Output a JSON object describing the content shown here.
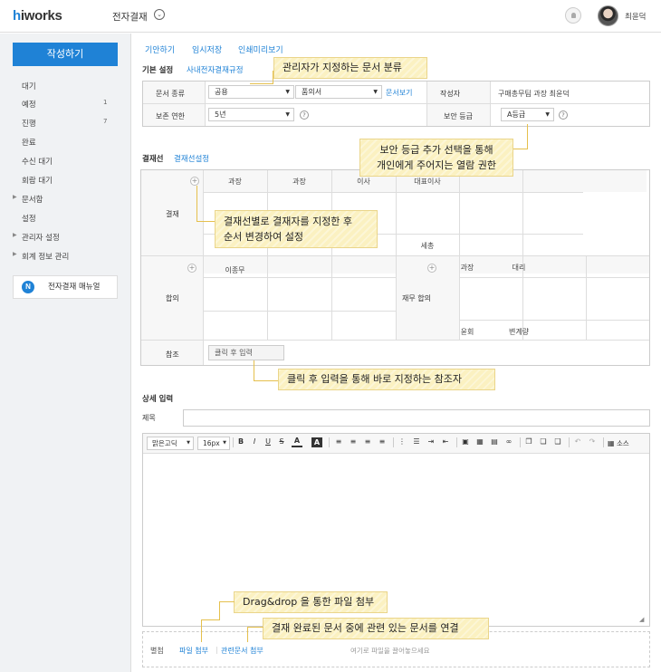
{
  "header": {
    "logo_h": "h",
    "logo_rest": "iworks",
    "app_title": "전자결재",
    "chevron": "⌄",
    "user_name": "최윤덕"
  },
  "sidebar": {
    "write_button": "작성하기",
    "items": [
      {
        "label": "대기",
        "count": ""
      },
      {
        "label": "예정",
        "count": "1"
      },
      {
        "label": "진행",
        "count": "7"
      },
      {
        "label": "완료",
        "count": ""
      },
      {
        "label": "수신 대기",
        "count": ""
      },
      {
        "label": "회람 대기",
        "count": ""
      },
      {
        "label": "문서함",
        "count": ""
      },
      {
        "label": "설정",
        "count": ""
      },
      {
        "label": "관리자 설정",
        "count": ""
      },
      {
        "label": "회계 정보 관리",
        "count": ""
      }
    ],
    "manual_icon": "N",
    "manual_label": "전자결재 매뉴얼"
  },
  "actions": {
    "draft": "기안하기",
    "temp_save": "임시저장",
    "print_preview": "인쇄미리보기"
  },
  "basic": {
    "title": "기본 설정",
    "rules_link": "사내전자결재규정",
    "doc_type_label": "문서 종류",
    "doc_type_value": "공용",
    "form_value": "품의서",
    "doc_view": "문서보기",
    "author_label": "작성자",
    "author_value": "구매총무팀 과장 최윤덕",
    "retention_label": "보존 연한",
    "retention_value": "5년",
    "security_label": "보안 등급",
    "security_value": "A등급",
    "help": "?"
  },
  "approval_line": {
    "title": "결재선",
    "settings_link": "결재선설정",
    "approve_label": "결재",
    "approve_positions": [
      "과장",
      "과장",
      "이사",
      "대표이사"
    ],
    "approve_name": "세총",
    "agree_label": "합의",
    "agree_name": "이종무",
    "finance_label": "재무 합의",
    "finance_positions": [
      "과장",
      "대리"
    ],
    "finance_names": [
      "윤회",
      "변계량"
    ],
    "ref_label": "참조",
    "ref_input": "클릭 후 입력",
    "plus": "+"
  },
  "detail": {
    "title": "상세 입력",
    "subject_label": "제목",
    "subject_value": ""
  },
  "editor": {
    "font": "맑은고딕",
    "size": "16px",
    "bold": "B",
    "italic": "I",
    "underline": "U",
    "strike": "S",
    "font_color": "A",
    "bg_color": "A",
    "source": "소스"
  },
  "attach": {
    "label": "별첨",
    "file_attach": "파일 첨부",
    "related_attach": "관련문서 첨부",
    "drop_hint": "여기로 파일을 끌어놓으세요"
  },
  "callouts": {
    "doc_class": "관리자가 지정하는 문서 분류",
    "security_line1": "보안 등급 추가 선택을 통해",
    "security_line2": "개인에게 주어지는 열람 권한",
    "approval_line1": "결재선별로 결재자를 지정한 후",
    "approval_line2": "순서 변경하여 설정",
    "reference": "클릭 후 입력을 통해 바로 지정하는 참조자",
    "dragdrop": "Drag&drop 을 통한 파일 첨부",
    "related": "결재 완료된 문서 중에 관련 있는 문서를 연결"
  },
  "colors": {
    "accent": "#1f82d6",
    "callout_bg": "#fbf1c1",
    "callout_line": "#e5c04d",
    "sidebar_bg": "#f0f2f4"
  }
}
